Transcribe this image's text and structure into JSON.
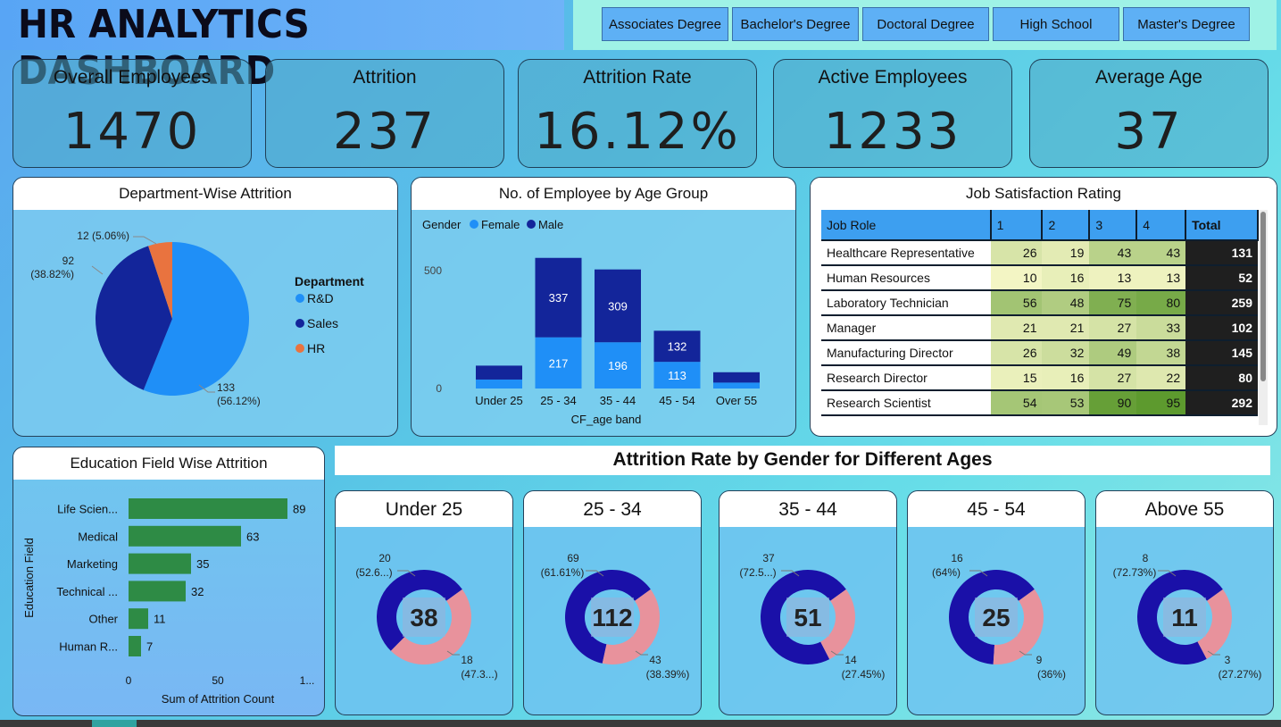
{
  "title": "HR ANALYTICS DASHBOARD",
  "filters": [
    "Associates Degree",
    "Bachelor's Degree",
    "Doctoral Degree",
    "High School",
    "Master's Degree"
  ],
  "kpis": [
    {
      "label": "Overall Employees",
      "value": "1470"
    },
    {
      "label": "Attrition",
      "value": "237"
    },
    {
      "label": "Attrition Rate",
      "value": "16.12%"
    },
    {
      "label": "Active Employees",
      "value": "1233"
    },
    {
      "label": "Average Age",
      "value": "37"
    }
  ],
  "dept": {
    "title": "Department-Wise Attrition",
    "legend_title": "Department",
    "chart_data": {
      "type": "pie",
      "slices": [
        {
          "name": "R&D",
          "value": 133,
          "label1": "133",
          "label2": "(56.12%)",
          "color": "#1f8ff7"
        },
        {
          "name": "Sales",
          "value": 92,
          "label1": "92",
          "label2": "(38.82%)",
          "color": "#13259a"
        },
        {
          "name": "HR",
          "value": 12,
          "label1": "12 (5.06%)",
          "label2": "",
          "color": "#e9733f"
        }
      ]
    }
  },
  "age": {
    "title": "No. of Employee by Age Group",
    "legend_title": "Gender",
    "chart_data": {
      "type": "bar",
      "categories": [
        "Under 25",
        "25 - 34",
        "35 - 44",
        "45 - 54",
        "Over 55"
      ],
      "series": [
        {
          "name": "Female",
          "values": [
            38,
            217,
            196,
            113,
            25
          ],
          "color": "#1f8ff7"
        },
        {
          "name": "Male",
          "values": [
            59,
            337,
            309,
            132,
            44
          ],
          "color": "#13259a"
        }
      ],
      "shown_labels": {
        "Female": [
          "",
          "217",
          "196",
          "113",
          ""
        ],
        "Male": [
          "",
          "337",
          "309",
          "132",
          ""
        ]
      },
      "xlabel": "CF_age band",
      "yticks": [
        "0",
        "500"
      ],
      "ylim": [
        0,
        600
      ]
    }
  },
  "job": {
    "title": "Job Satisfaction Rating",
    "headers": [
      "Job Role",
      "1",
      "2",
      "3",
      "4",
      "Total"
    ],
    "rows": [
      {
        "role": "Healthcare Representative",
        "vals": [
          "26",
          "19",
          "43",
          "43"
        ],
        "total": "131"
      },
      {
        "role": "Human Resources",
        "vals": [
          "10",
          "16",
          "13",
          "13"
        ],
        "total": "52"
      },
      {
        "role": "Laboratory Technician",
        "vals": [
          "56",
          "48",
          "75",
          "80"
        ],
        "total": "259"
      },
      {
        "role": "Manager",
        "vals": [
          "21",
          "21",
          "27",
          "33"
        ],
        "total": "102"
      },
      {
        "role": "Manufacturing Director",
        "vals": [
          "26",
          "32",
          "49",
          "38"
        ],
        "total": "145"
      },
      {
        "role": "Research Director",
        "vals": [
          "15",
          "16",
          "27",
          "22"
        ],
        "total": "80"
      },
      {
        "role": "Research Scientist",
        "vals": [
          "54",
          "53",
          "90",
          "95"
        ],
        "total": "292"
      }
    ]
  },
  "edu": {
    "title": "Education Field Wise Attrition",
    "chart_data": {
      "type": "bar",
      "orientation": "horizontal",
      "categories": [
        "Life Scien...",
        "Medical",
        "Marketing",
        "Technical ...",
        "Other",
        "Human R..."
      ],
      "values": [
        89,
        63,
        35,
        32,
        11,
        7
      ],
      "xlabel": "Sum of Attrition Count",
      "ylabel": "Education Field",
      "xticks": [
        "0",
        "50",
        "1..."
      ],
      "xlim": [
        0,
        100
      ],
      "color": "#2e8b45"
    }
  },
  "gender_title": "Attrition Rate by Gender for Different Ages",
  "donuts": [
    {
      "title": "Under 25",
      "total": "38",
      "male": 20,
      "female": 18,
      "male_l1": "20",
      "male_l2": "(52.6...)",
      "female_l1": "18",
      "female_l2": "(47.3...)"
    },
    {
      "title": "25 - 34",
      "total": "112",
      "male": 69,
      "female": 43,
      "male_l1": "69",
      "male_l2": "(61.61%)",
      "female_l1": "43",
      "female_l2": "(38.39%)"
    },
    {
      "title": "35 - 44",
      "total": "51",
      "male": 37,
      "female": 14,
      "male_l1": "37",
      "male_l2": "(72.5...)",
      "female_l1": "14",
      "female_l2": "(27.45%)"
    },
    {
      "title": "45 - 54",
      "total": "25",
      "male": 16,
      "female": 9,
      "male_l1": "16",
      "male_l2": "(64%)",
      "female_l1": "9",
      "female_l2": "(36%)"
    },
    {
      "title": "Above 55",
      "total": "11",
      "male": 8,
      "female": 3,
      "male_l1": "8",
      "male_l2": "(72.73%)",
      "female_l1": "3",
      "female_l2": "(27.27%)"
    }
  ],
  "colors": {
    "male": "#1a10a8",
    "female": "#e8929c",
    "heat_low": "#f3f5c4",
    "heat_high": "#5d9a2e"
  }
}
